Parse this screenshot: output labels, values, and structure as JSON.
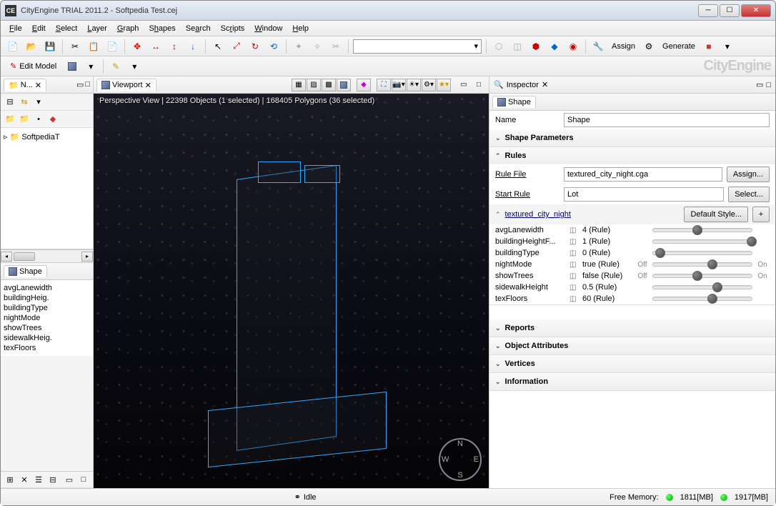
{
  "titlebar": {
    "app_icon": "CE",
    "title": "CityEngine TRIAL 2011.2 - Softpedia Test.cej"
  },
  "menu": [
    "File",
    "Edit",
    "Select",
    "Layer",
    "Graph",
    "Shapes",
    "Search",
    "Scripts",
    "Window",
    "Help"
  ],
  "toolbar": {
    "assign": "Assign",
    "generate": "Generate",
    "brand": "CityEngine",
    "edit_model": "Edit Model"
  },
  "left": {
    "nav_tab": "N...",
    "tree_root": "SoftpediaT",
    "shape_tab": "Shape",
    "shape_items": [
      "avgLanewidth",
      "buildingHeig.",
      "buildingType",
      "nightMode",
      "showTrees",
      "sidewalkHeig.",
      "texFloors"
    ]
  },
  "viewport": {
    "tab": "Viewport",
    "status": "Perspective View  |  22398 Objects  (1 selected)  |  168405 Polygons  (36 selected)"
  },
  "inspector": {
    "title": "Inspector",
    "tab": "Shape",
    "name_label": "Name",
    "name_value": "Shape",
    "sec_params": "Shape Parameters",
    "sec_rules": "Rules",
    "rule_file_label": "Rule File",
    "rule_file_value": "textured_city_night.cga",
    "assign_btn": "Assign...",
    "start_rule_label": "Start Rule",
    "start_rule_value": "Lot",
    "select_btn": "Select...",
    "style_link": "textured_city_night",
    "default_style_btn": "Default Style...",
    "params": [
      {
        "name": "avgLanewidth",
        "val": "4 (Rule)",
        "pos": 40,
        "left": "",
        "right": ""
      },
      {
        "name": "buildingHeightF...",
        "val": "1 (Rule)",
        "pos": 95,
        "left": "",
        "right": ""
      },
      {
        "name": "buildingType",
        "val": "0 (Rule)",
        "pos": 2,
        "left": "",
        "right": ""
      },
      {
        "name": "nightMode",
        "val": "true (Rule)",
        "pos": 55,
        "left": "Off",
        "right": "On"
      },
      {
        "name": "showTrees",
        "val": "false (Rule)",
        "pos": 40,
        "left": "Off",
        "right": "On"
      },
      {
        "name": "sidewalkHeight",
        "val": "0.5 (Rule)",
        "pos": 60,
        "left": "",
        "right": ""
      },
      {
        "name": "texFloors",
        "val": "60 (Rule)",
        "pos": 55,
        "left": "",
        "right": ""
      }
    ],
    "sec_reports": "Reports",
    "sec_attrs": "Object Attributes",
    "sec_verts": "Vertices",
    "sec_info": "Information"
  },
  "status": {
    "idle": "Idle",
    "mem_label": "Free Memory:",
    "mem1": "1811[MB]",
    "mem2": "1917[MB]"
  }
}
